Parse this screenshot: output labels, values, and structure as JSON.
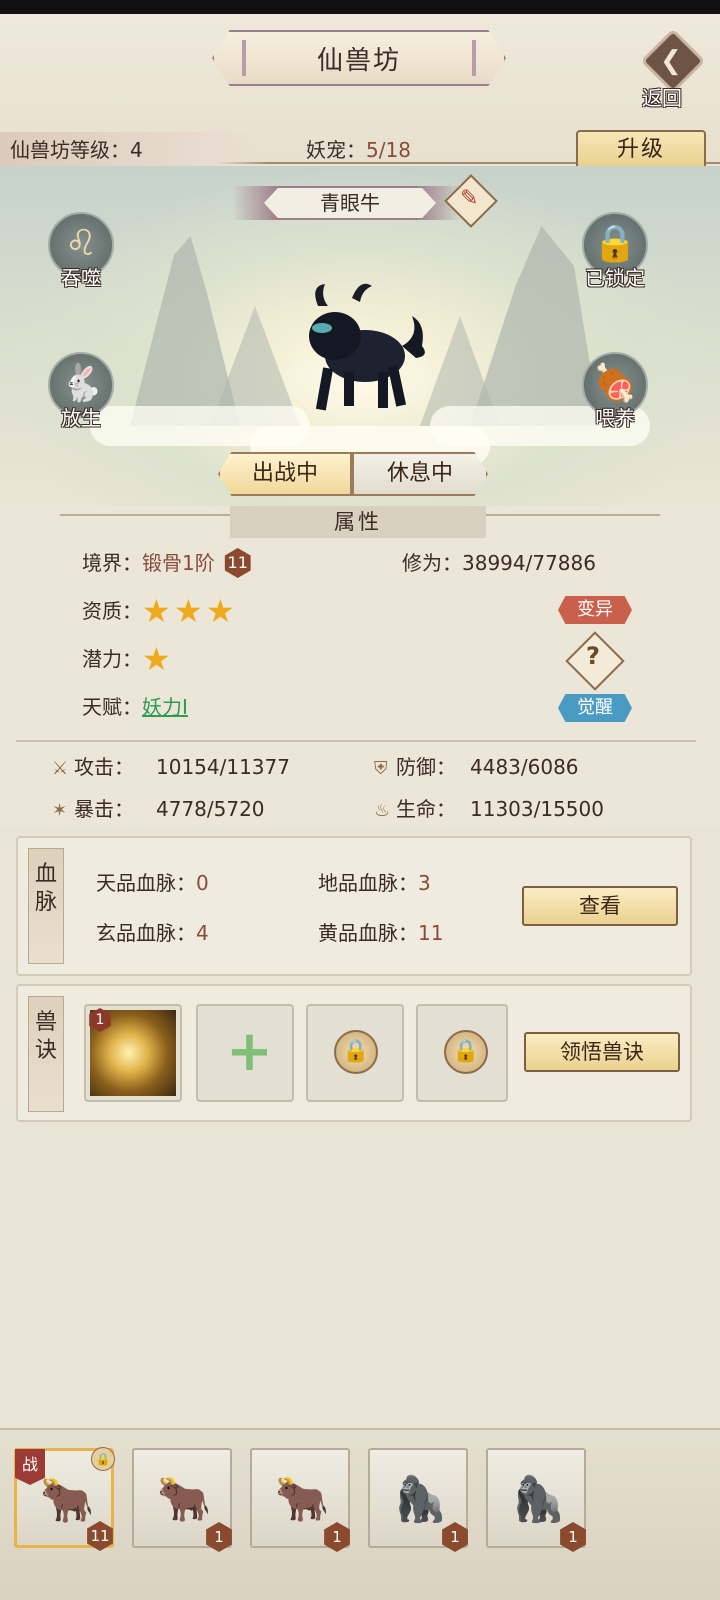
{
  "header": {
    "title": "仙兽坊",
    "back_label": "返回",
    "level_label": "仙兽坊等级：",
    "level_value": "4",
    "pets_label": "妖宠：",
    "pets_value": "5/18",
    "upgrade_label": "升级"
  },
  "pet": {
    "name": "青眼牛",
    "actions_left": [
      {
        "label": "吞噬",
        "icon": "lion-head-icon"
      },
      {
        "label": "放生",
        "icon": "rabbit-icon"
      }
    ],
    "actions_right": [
      {
        "label": "已锁定",
        "icon": "lock-icon"
      },
      {
        "label": "喂养",
        "icon": "meat-icon"
      }
    ],
    "status_active": "出战中",
    "status_rest": "休息中"
  },
  "attributes": {
    "header": "属性",
    "realm_label": "境界：",
    "realm_value": "锻骨1阶",
    "realm_level": "11",
    "cultivation_label": "修为：",
    "cultivation_value": "38994/77886",
    "quality_label": "资质：",
    "quality_stars": 3,
    "potential_label": "潜力：",
    "potential_stars": 1,
    "talent_label": "天赋：",
    "talent_value": "妖力I",
    "mutate_label": "变异",
    "help_label": "?",
    "awaken_label": "觉醒",
    "attack_label": "攻击：",
    "attack_value": "10154/11377",
    "defense_label": "防御：",
    "defense_value": "4483/6086",
    "crit_label": "暴击：",
    "crit_value": "4778/5720",
    "hp_label": "生命：",
    "hp_value": "11303/15500"
  },
  "bloodline": {
    "tab": "血脉",
    "tian_label": "天品血脉：",
    "tian_value": "0",
    "di_label": "地品血脉：",
    "di_value": "3",
    "xuan_label": "玄品血脉：",
    "xuan_value": "4",
    "huang_label": "黄品血脉：",
    "huang_value": "11",
    "view_label": "查看"
  },
  "skills": {
    "tab": "兽诀",
    "slot1_level": "1",
    "learn_label": "领悟兽诀"
  },
  "roster": [
    {
      "level": "11",
      "selected": true,
      "battle": "战"
    },
    {
      "level": "1"
    },
    {
      "level": "1"
    },
    {
      "level": "1"
    },
    {
      "level": "1"
    }
  ]
}
